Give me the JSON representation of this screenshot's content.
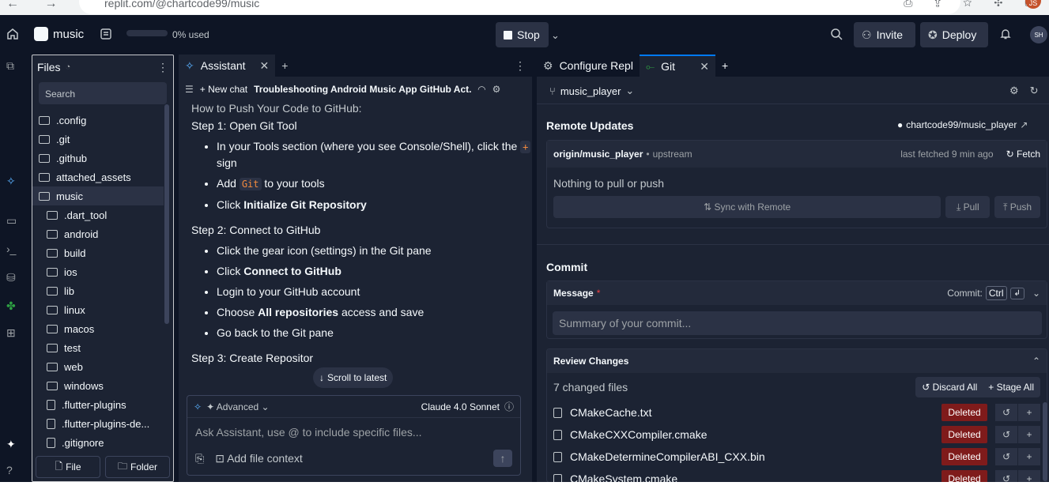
{
  "browser": {
    "url": "replit.com/@chartcode99/music",
    "profile": "JS"
  },
  "topbar": {
    "project_name": "music",
    "usage": "0% used",
    "stop_label": "Stop",
    "invite_label": "Invite",
    "deploy_label": "Deploy",
    "avatar": "SH"
  },
  "files": {
    "title": "Files",
    "search_placeholder": "Search",
    "items": [
      {
        "name": ".config",
        "kind": "folder",
        "level": 0
      },
      {
        "name": ".git",
        "kind": "folder",
        "level": 0
      },
      {
        "name": ".github",
        "kind": "folder",
        "level": 0
      },
      {
        "name": "attached_assets",
        "kind": "folder",
        "level": 0
      },
      {
        "name": "music",
        "kind": "folder",
        "level": 0,
        "selected": true
      },
      {
        "name": ".dart_tool",
        "kind": "folder",
        "level": 1
      },
      {
        "name": "android",
        "kind": "folder",
        "level": 1
      },
      {
        "name": "build",
        "kind": "folder",
        "level": 1
      },
      {
        "name": "ios",
        "kind": "folder",
        "level": 1
      },
      {
        "name": "lib",
        "kind": "folder",
        "level": 1
      },
      {
        "name": "linux",
        "kind": "folder",
        "level": 1
      },
      {
        "name": "macos",
        "kind": "folder",
        "level": 1
      },
      {
        "name": "test",
        "kind": "folder",
        "level": 1
      },
      {
        "name": "web",
        "kind": "folder",
        "level": 1
      },
      {
        "name": "windows",
        "kind": "folder",
        "level": 1
      },
      {
        "name": ".flutter-plugins",
        "kind": "file",
        "level": 1
      },
      {
        "name": ".flutter-plugins-de...",
        "kind": "file",
        "level": 1
      },
      {
        "name": ".gitignore",
        "kind": "file",
        "level": 1
      }
    ],
    "file_button": "File",
    "folder_button": "Folder"
  },
  "assistant": {
    "tab_label": "Assistant",
    "new_chat": "New chat",
    "chat_title": "Troubleshooting Android Music App GitHub Act...",
    "intro": "How to Push Your Code to GitHub:",
    "step1": "Step 1: Open Git Tool",
    "s1_b1_a": "In your Tools section (where you see Console/Shell), click the",
    "s1_b1_code": "+",
    "s1_b1_b": "sign",
    "s1_b2_a": "Add",
    "s1_b2_code": "Git",
    "s1_b2_b": "to your tools",
    "s1_b3_a": "Click",
    "s1_b3_bold": "Initialize Git Repository",
    "step2": "Step 2: Connect to GitHub",
    "s2_b1": "Click the gear icon (settings) in the Git pane",
    "s2_b2_a": "Click",
    "s2_b2_bold": "Connect to GitHub",
    "s2_b3": "Login to your GitHub account",
    "s2_b4_a": "Choose",
    "s2_b4_bold": "All repositories",
    "s2_b4_b": "access and save",
    "s2_b5": "Go back to the Git pane",
    "step3": "Step 3: Create Repositor",
    "scroll_latest": "Scroll to latest",
    "advanced": "Advanced",
    "model": "Claude 4.0 Sonnet",
    "input_placeholder": "Ask Assistant, use @ to include specific files...",
    "add_context": "Add file context"
  },
  "git": {
    "tab_configure": "Configure Repl",
    "tab_git": "Git",
    "branch": "music_player",
    "remote_title": "Remote Updates",
    "repo": "chartcode99/music_player",
    "origin": "origin/music_player",
    "upstream": "upstream",
    "last_fetched": "last fetched 9 min ago",
    "fetch": "Fetch",
    "nothing": "Nothing to pull or push",
    "sync": "Sync with Remote",
    "pull": "Pull",
    "push": "Push",
    "commit_title": "Commit",
    "message_label": "Message",
    "required": "*",
    "commit_shortcut": "Commit:",
    "ctrl": "Ctrl",
    "summary_placeholder": "Summary of your commit...",
    "review_title": "Review Changes",
    "changed_count": "7 changed files",
    "discard_all": "Discard All",
    "stage_all": "Stage All",
    "changes": [
      {
        "file": "CMakeCache.txt",
        "status": "Deleted"
      },
      {
        "file": "CMakeCXXCompiler.cmake",
        "status": "Deleted"
      },
      {
        "file": "CMakeDetermineCompilerABI_CXX.bin",
        "status": "Deleted"
      },
      {
        "file": "CMakeSystem.cmake",
        "status": "Deleted"
      }
    ]
  }
}
